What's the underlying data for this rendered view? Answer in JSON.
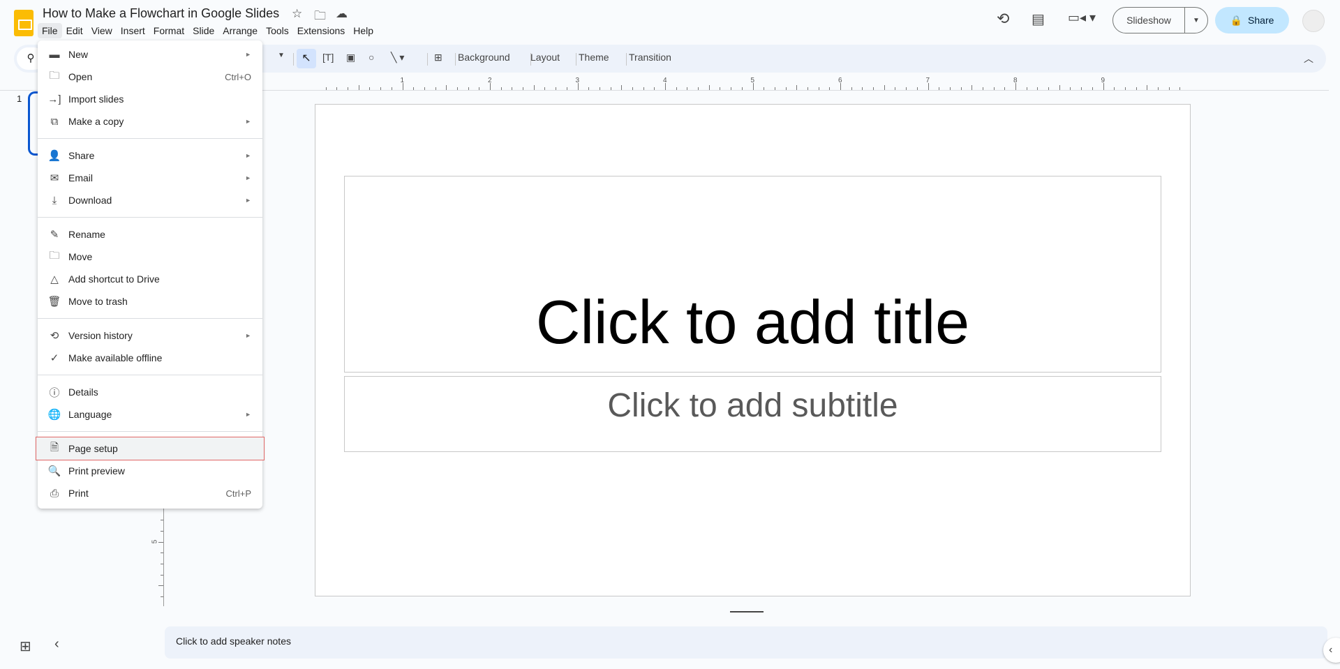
{
  "app": {
    "title": "How to Make a Flowchart in Google Slides",
    "brand_color": "#fbbc04",
    "accent": "#0b57d0"
  },
  "menubar": [
    "File",
    "Edit",
    "View",
    "Insert",
    "Format",
    "Slide",
    "Arrange",
    "Tools",
    "Extensions",
    "Help"
  ],
  "header": {
    "slideshow_label": "Slideshow",
    "share_label": "Share"
  },
  "toolbar": {
    "background": "Background",
    "layout": "Layout",
    "theme": "Theme",
    "transition": "Transition"
  },
  "ruler": {
    "h_labels": [
      "1",
      "2",
      "3",
      "4",
      "5",
      "6",
      "7",
      "8",
      "9"
    ],
    "v_label": "5"
  },
  "filmstrip": {
    "slide_number": "1"
  },
  "slide": {
    "title_placeholder": "Click to add title",
    "subtitle_placeholder": "Click to add subtitle"
  },
  "notes": {
    "placeholder": "Click to add speaker notes"
  },
  "file_menu": {
    "groups": [
      [
        {
          "label": "New",
          "icon": "new-slides-icon",
          "submenu": true
        },
        {
          "label": "Open",
          "icon": "folder-icon",
          "shortcut": "Ctrl+O"
        },
        {
          "label": "Import slides",
          "icon": "import-icon"
        },
        {
          "label": "Make a copy",
          "icon": "copy-icon",
          "submenu": true
        }
      ],
      [
        {
          "label": "Share",
          "icon": "person-add-icon",
          "submenu": true
        },
        {
          "label": "Email",
          "icon": "mail-icon",
          "submenu": true
        },
        {
          "label": "Download",
          "icon": "download-icon",
          "submenu": true
        }
      ],
      [
        {
          "label": "Rename",
          "icon": "rename-icon"
        },
        {
          "label": "Move",
          "icon": "move-folder-icon"
        },
        {
          "label": "Add shortcut to Drive",
          "icon": "drive-shortcut-icon"
        },
        {
          "label": "Move to trash",
          "icon": "trash-icon"
        }
      ],
      [
        {
          "label": "Version history",
          "icon": "history-icon",
          "submenu": true
        },
        {
          "label": "Make available offline",
          "icon": "offline-icon"
        }
      ],
      [
        {
          "label": "Details",
          "icon": "info-icon"
        },
        {
          "label": "Language",
          "icon": "globe-icon",
          "submenu": true
        }
      ],
      [
        {
          "label": "Page setup",
          "icon": "page-icon",
          "highlighted": true
        },
        {
          "label": "Print preview",
          "icon": "print-preview-icon"
        },
        {
          "label": "Print",
          "icon": "print-icon",
          "shortcut": "Ctrl+P"
        }
      ]
    ]
  }
}
